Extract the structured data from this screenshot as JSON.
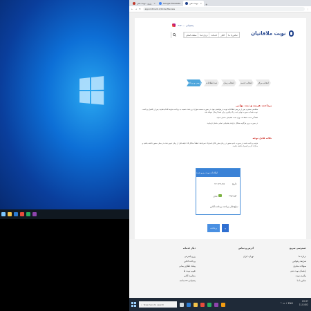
{
  "colors": {
    "accent": "#3b82d6",
    "title_red": "#d0342c",
    "step_active": "#4ea6dc",
    "taskbar": "#1f2a38"
  },
  "left_screen": {
    "clock": {
      "time": "03:37",
      "date": "11/1402"
    }
  },
  "browser": {
    "tabs": [
      {
        "label": "رزرو - نوبت دهی",
        "active": false
      },
      {
        "label": "Google Translate",
        "active": false
      },
      {
        "label": "نوبت دهی",
        "active": true
      }
    ],
    "new_tab": "+",
    "url": "appointment.ir/Order/Review",
    "nav": {
      "back": "←",
      "forward": "→",
      "reload": "↻"
    }
  },
  "site": {
    "logo": "نوبت ملاقاتیان",
    "contact": "پشتیبانی ۰۹۱۲۰۰۰",
    "menu": [
      "صفحه اصلی",
      "درباره ما",
      "خدمات",
      "اخبار",
      "تماس با ما"
    ],
    "search_icon": "search-icon",
    "steps": [
      {
        "label": "انتخاب مرکز",
        "active": false
      },
      {
        "label": "انتخاب خدمت",
        "active": false
      },
      {
        "label": "انتخاب زمان",
        "active": false
      },
      {
        "label": "ثبت اطلاعات",
        "active": false
      },
      {
        "label": "بازبینی و پرداخت",
        "active": true
      }
    ],
    "section_title": "پرداخت هزینه و ثبت نهایی",
    "paragraph1": "متقاضی محترم، پس از بررسی اطلاعات نوبت درخواستی خود، در صورت صحت موارد درج شده نسبت به پرداخت هزینه اقدام نمایید. پس از تکمیل پرداخت، نوبت شما به صورت نهایی ثبت و کد پیگیری برای شما ارسال خواهد شد.",
    "paragraph2": "لطفاً از صحت اطلاعات وارد شده اطمینان حاصل نمایید.",
    "paragraph3": "در صورت بروز هرگونه مشکل با واحد پشتیبانی تماس حاصل فرمایید.",
    "note_title": "نکات قابل توجه",
    "note_text": "هزینه پرداخت شده در صورت عدم حضور در زمان مقرر قابل استرداد نمی‌باشد. لطفاً حداقل ۱۵ دقیقه قبل از زمان تعیین شده در محل حضور داشته باشید و مدارک لازم را همراه داشته باشید.",
    "card": {
      "header": "اطلاعات نوبت رزرو شده",
      "rows": [
        {
          "label": "تاریخ:",
          "value": "۱۴۰۲/۱۱/۱۵"
        },
        {
          "label": "نوع نوبت:",
          "value": "عادی"
        },
        {
          "label": "مبلغ قابل پرداخت:",
          "value": "پرداخت آنلاین"
        }
      ]
    },
    "btn_prev": "پرداخت",
    "btn_next": "»",
    "footer": {
      "columns": [
        {
          "title": "دسترسی سریع",
          "items": [
            "درباره ما",
            "شرایط و قوانین",
            "سوالات متداول",
            "راهنمای نوبت دهی",
            "پیگیری نوبت",
            "تماس با ما"
          ]
        },
        {
          "title": "آدرس و تماس",
          "items": [
            "تهران، ایران"
          ]
        },
        {
          "title": "دیگر خدمات",
          "items": [
            "رزرو اینترنتی",
            "پرداخت آنلاین",
            "پیامک اطلاع رسانی",
            "تقویم نوبت ها",
            "مشاوره آنلاین",
            "پشتیبانی ۲۴ ساعته"
          ]
        }
      ]
    }
  },
  "taskbar": {
    "search_placeholder": "Type here to search",
    "clock": {
      "time": "03:37",
      "date": "11/1402"
    },
    "lang": "ENG"
  }
}
